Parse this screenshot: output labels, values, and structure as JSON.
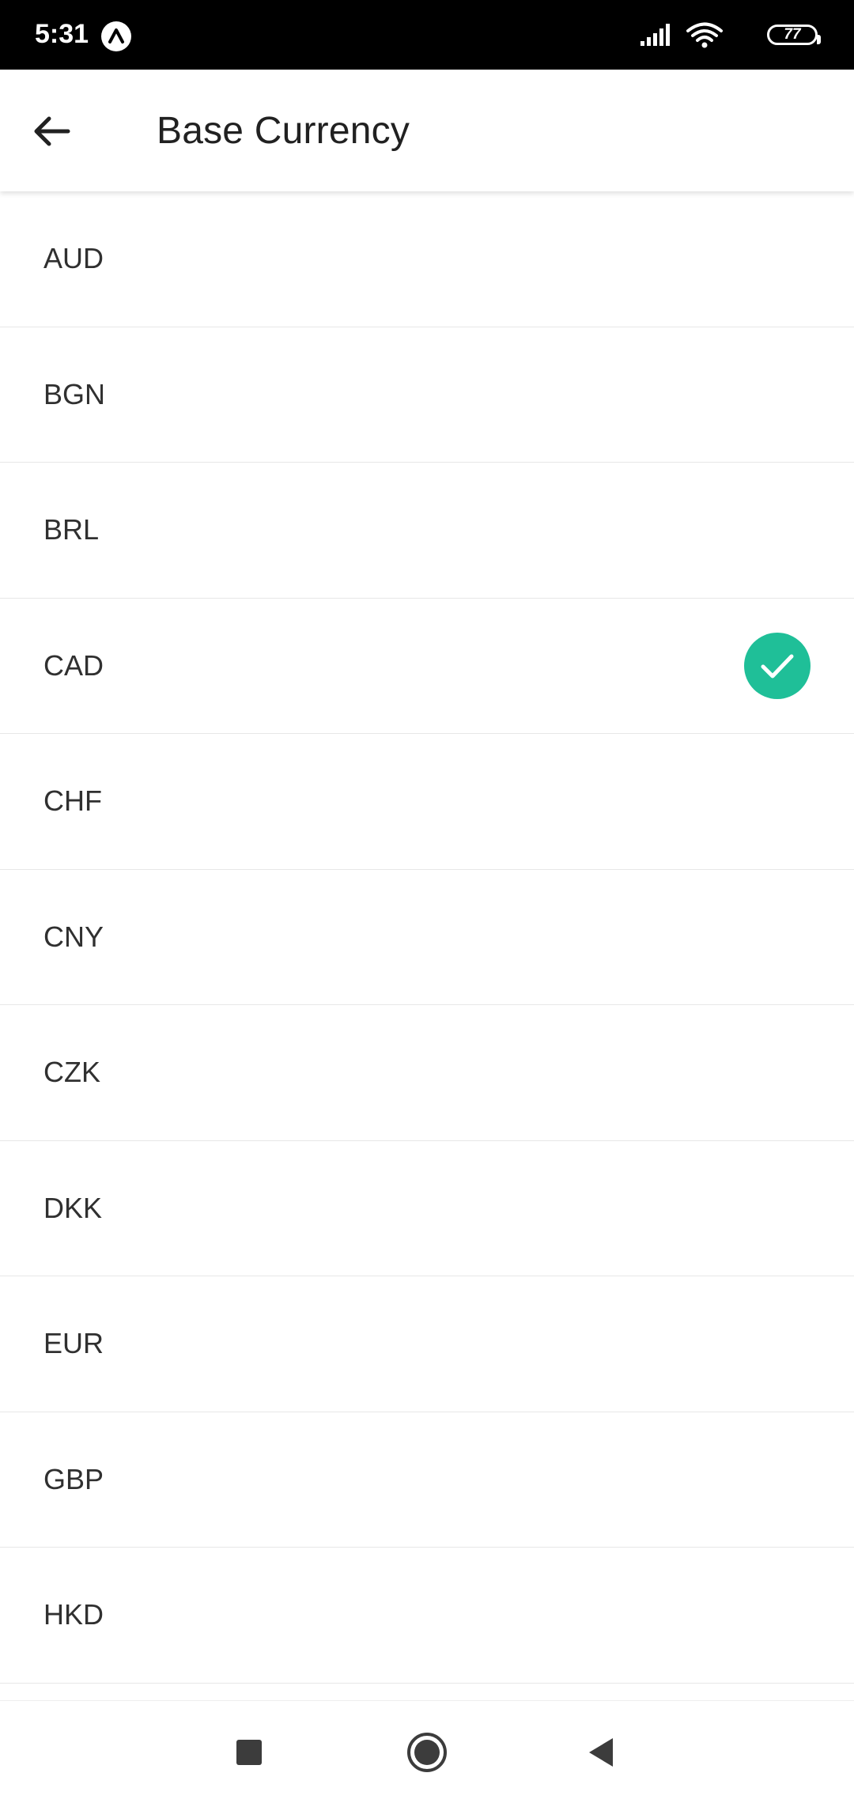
{
  "status_bar": {
    "time": "5:31",
    "battery": "77",
    "app_icon": "caret-up-icon",
    "signal_icon": "cell-signal-icon",
    "wifi_icon": "wifi-icon"
  },
  "header": {
    "title": "Base Currency",
    "back_icon": "arrow-left-icon"
  },
  "currencies": [
    {
      "code": "AUD",
      "selected": false
    },
    {
      "code": "BGN",
      "selected": false
    },
    {
      "code": "BRL",
      "selected": false
    },
    {
      "code": "CAD",
      "selected": true
    },
    {
      "code": "CHF",
      "selected": false
    },
    {
      "code": "CNY",
      "selected": false
    },
    {
      "code": "CZK",
      "selected": false
    },
    {
      "code": "DKK",
      "selected": false
    },
    {
      "code": "EUR",
      "selected": false
    },
    {
      "code": "GBP",
      "selected": false
    },
    {
      "code": "HKD",
      "selected": false
    }
  ],
  "selected_icon": "check-circle-icon",
  "nav_bar": {
    "recents_icon": "square-icon",
    "home_icon": "circle-icon",
    "back_icon": "triangle-back-icon"
  },
  "colors": {
    "accent": "#1fbf98",
    "status_bar_bg": "#000000",
    "text_primary": "#212121"
  }
}
